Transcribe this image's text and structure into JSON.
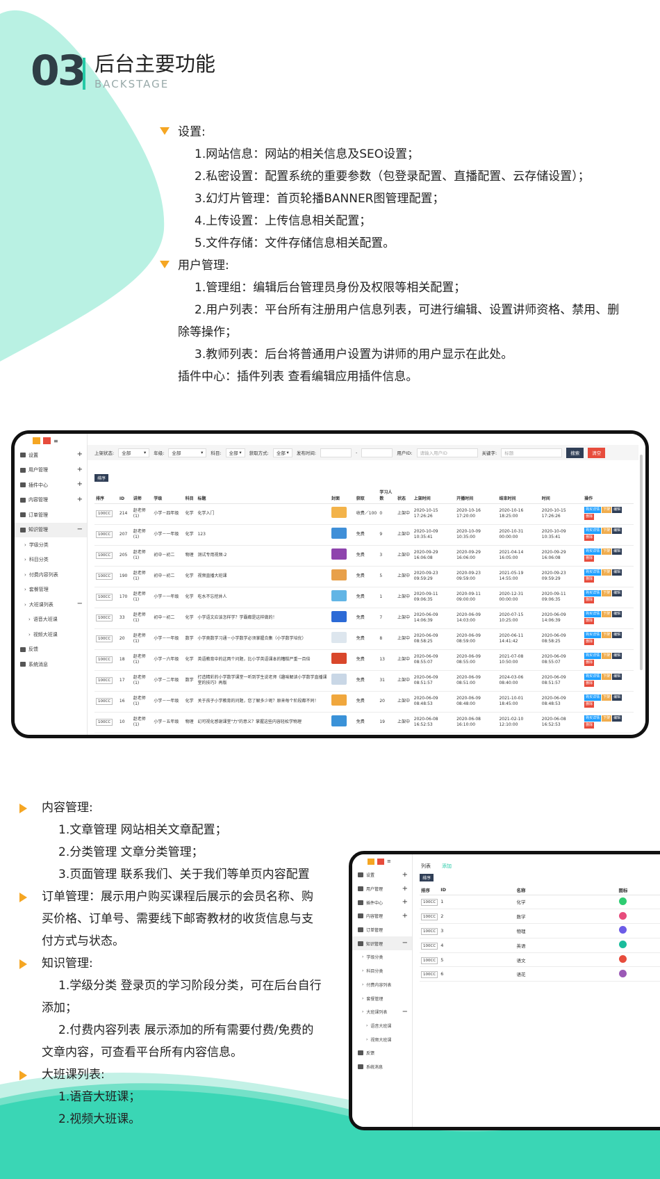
{
  "header": {
    "number": "03",
    "title": "后台主要功能",
    "subtitle": "BACKSTAGE"
  },
  "colors": {
    "accent": "#25c9a6",
    "bullet": "#f5a623",
    "blob": "#b9f1e3",
    "wave": "#3ad6b5"
  },
  "section1": {
    "lines": [
      {
        "type": "head",
        "text": "设置:"
      },
      {
        "type": "item",
        "text": "1.网站信息：网站的相关信息及SEO设置；"
      },
      {
        "type": "item",
        "text": "2.私密设置：配置系统的重要参数（包登录配置、直播配置、云存储设置）；"
      },
      {
        "type": "item",
        "text": "3.幻灯片管理：首页轮播BANNER图管理配置；"
      },
      {
        "type": "item",
        "text": "4.上传设置：上传信息相关配置；"
      },
      {
        "type": "item",
        "text": "5.文件存储：文件存储信息相关配置。"
      },
      {
        "type": "head",
        "text": "用户管理:"
      },
      {
        "type": "item",
        "text": "1.管理组：编辑后台管理员身份及权限等相关配置；"
      },
      {
        "type": "item",
        "text": "2.用户列表：平台所有注册用户信息列表，可进行编辑、设置讲师资格、禁用、删"
      },
      {
        "type": "cont",
        "text": "除等操作；"
      },
      {
        "type": "item",
        "text": "3.教师列表：后台将普通用户设置为讲师的用户显示在此处。"
      },
      {
        "type": "plain",
        "text": "插件中心：插件列表 查看编辑应用插件信息。"
      }
    ]
  },
  "section2": {
    "lines": [
      {
        "type": "head",
        "text": "内容管理:"
      },
      {
        "type": "item",
        "text": "1.文章管理 网站相关文章配置；"
      },
      {
        "type": "item",
        "text": "2.分类管理 文章分类管理；"
      },
      {
        "type": "item",
        "text": "3.页面管理 联系我们、关于我们等单页内容配置"
      },
      {
        "type": "head",
        "text": "订单管理：展示用户购买课程后展示的会员名称、购"
      },
      {
        "type": "cont",
        "text": "买价格、订单号、需要线下邮寄教材的收货信息与支"
      },
      {
        "type": "cont",
        "text": "付方式与状态。"
      },
      {
        "type": "head",
        "text": "知识管理:"
      },
      {
        "type": "item",
        "text": "1.学级分类 登录页的学习阶段分类，可在后台自行"
      },
      {
        "type": "cont",
        "text": "添加；"
      },
      {
        "type": "item",
        "text": " 2.付费内容列表 展示添加的所有需要付费/免费的"
      },
      {
        "type": "cont",
        "text": "文章内容，可查看平台所有内容信息。"
      },
      {
        "type": "head",
        "text": "大班课列表:"
      },
      {
        "type": "item",
        "text": "1.语音大班课；"
      },
      {
        "type": "item",
        "text": "2.视频大班课。"
      }
    ]
  },
  "sidebar": {
    "items": [
      {
        "label": "设置",
        "pm": "+",
        "level": 0,
        "icon": "gear-icon"
      },
      {
        "label": "用户管理",
        "pm": "+",
        "level": 0,
        "icon": "users-icon"
      },
      {
        "label": "插件中心",
        "pm": "+",
        "level": 0,
        "icon": "cloud-icon"
      },
      {
        "label": "内容管理",
        "pm": "+",
        "level": 0,
        "icon": "grid-icon"
      },
      {
        "label": "订单管理",
        "pm": "",
        "level": 0,
        "icon": "monitor-icon"
      },
      {
        "label": "知识管理",
        "pm": "−",
        "level": 0,
        "icon": "monitor-icon",
        "active": true
      },
      {
        "label": "学级分类",
        "pm": "",
        "level": 1
      },
      {
        "label": "科目分类",
        "pm": "",
        "level": 1
      },
      {
        "label": "付费内容列表",
        "pm": "",
        "level": 1
      },
      {
        "label": "套餐管理",
        "pm": "",
        "level": 1
      },
      {
        "label": "大班课列表",
        "pm": "−",
        "level": 1
      },
      {
        "label": "语音大班课",
        "pm": "",
        "level": 2
      },
      {
        "label": "视频大班课",
        "pm": "",
        "level": 2
      },
      {
        "label": "反馈",
        "pm": "",
        "level": 0,
        "icon": "monitor-icon"
      },
      {
        "label": "系统消息",
        "pm": "",
        "level": 0,
        "icon": "monitor-icon"
      }
    ]
  },
  "filters": {
    "status_label": "上架状态:",
    "status_value": "全部",
    "grade_label": "年级:",
    "grade_value": "全部",
    "subject_label": "科目:",
    "subject_value": "全部",
    "method_label": "获取方式:",
    "method_value": "全部",
    "time_label": "发布时间:",
    "time_sep": "-",
    "uid_label": "用户ID:",
    "uid_placeholder": "请输入用户ID",
    "kw_label": "关键字:",
    "kw_placeholder": "标题",
    "search_button": "搜索",
    "clear_button": "清空"
  },
  "table1": {
    "tag": "排序",
    "headers": [
      "排序",
      "ID",
      "讲师",
      "学级",
      "科目",
      "标题",
      "封面",
      "获取",
      "学习人数",
      "状态",
      "上架时间",
      "开播时间",
      "结束时间",
      "时间",
      "操作"
    ],
    "rows": [
      {
        "order": "100CC",
        "id": "214",
        "teacher": "赵老师(1)",
        "grade": "小学－四年级",
        "subject": "化学",
        "title": "化学入门",
        "cover": "#f3b34a",
        "get": "收费／100",
        "learn": "0",
        "status": "上架中",
        "up": "2020-10-15 17:26:26",
        "start": "2020-10-16 17:20:00",
        "end": "2020-10-16 18:25:00",
        "time": "2020-10-15 17:26:26"
      },
      {
        "order": "100CC",
        "id": "207",
        "teacher": "赵老师(1)",
        "grade": "小学－一年级",
        "subject": "化学",
        "title": "123",
        "cover": "#3f8fd8",
        "get": "免费",
        "learn": "9",
        "status": "上架中",
        "up": "2020-10-09 10:35:41",
        "start": "2020-10-09 10:35:00",
        "end": "2020-10-31 00:00:00",
        "time": "2020-10-09 10:35:41"
      },
      {
        "order": "100CC",
        "id": "205",
        "teacher": "赵老师(1)",
        "grade": "初中－初二",
        "subject": "物理",
        "title": "测试专用视频-2",
        "cover": "#8e44ad",
        "get": "免费",
        "learn": "3",
        "status": "上架中",
        "up": "2020-09-29 16:06:08",
        "start": "2020-09-29 16:06:00",
        "end": "2021-04-14 16:05:00",
        "time": "2020-09-29 16:06:08"
      },
      {
        "order": "100CC",
        "id": "190",
        "teacher": "赵老师(1)",
        "grade": "初中－初二",
        "subject": "化学",
        "title": "视频直播大班课",
        "cover": "#e8a04a",
        "get": "免费",
        "learn": "5",
        "status": "上架中",
        "up": "2020-09-23 09:59:29",
        "start": "2020-09-23 09:59:00",
        "end": "2021-05-19 14:55:00",
        "time": "2020-09-23 09:59:29"
      },
      {
        "order": "100CC",
        "id": "170",
        "teacher": "赵老师(1)",
        "grade": "小学－一年级",
        "subject": "化学",
        "title": "吃水不忘挖井人",
        "cover": "#62b5e5",
        "get": "免费",
        "learn": "1",
        "status": "上架中",
        "up": "2020-09-11 09:06:35",
        "start": "2020-09-11 09:00:00",
        "end": "2020-12-31 00:00:00",
        "time": "2020-09-11 09:06:35"
      },
      {
        "order": "100CC",
        "id": "33",
        "teacher": "赵老师(1)",
        "grade": "初中－初二",
        "subject": "化学",
        "title": "小学语文应该怎样学？学霸都是这样做的！",
        "cover": "#2c6ad6",
        "get": "免费",
        "learn": "7",
        "status": "上架中",
        "up": "2020-06-09 14:06:39",
        "start": "2020-06-09 14:03:00",
        "end": "2020-07-15 10:25:00",
        "time": "2020-06-09 14:06:39"
      },
      {
        "order": "100CC",
        "id": "20",
        "teacher": "赵老师(1)",
        "grade": "小学－一年级",
        "subject": "数学",
        "title": "小学奥数学习通－小学数学必须掌握合集（小学数学培优）",
        "cover": "#dde6ee",
        "get": "免费",
        "learn": "8",
        "status": "上架中",
        "up": "2020-06-09 08:58:25",
        "start": "2020-06-09 08:59:00",
        "end": "2020-06-11 14:41:42",
        "time": "2020-06-09 08:58:25"
      },
      {
        "order": "100CC",
        "id": "18",
        "teacher": "赵老师(1)",
        "grade": "小学－六年级",
        "subject": "化学",
        "title": "英语教育中的这两个问题，比小学英语课本的糟糕严重一百倍",
        "cover": "#d9472b",
        "get": "免费",
        "learn": "13",
        "status": "上架中",
        "up": "2020-06-09 08:55:07",
        "start": "2020-06-09 08:55:00",
        "end": "2021-07-08 10:50:00",
        "time": "2020-06-09 08:55:07"
      },
      {
        "order": "100CC",
        "id": "17",
        "teacher": "赵老师(1)",
        "grade": "小学－二年级",
        "subject": "数学",
        "title": "打造精彩的小学数学课堂一听到学生说老师《趣味解读小学数学直播课堂的技巧》再版",
        "cover": "#c9d7e6",
        "get": "免费",
        "learn": "31",
        "status": "上架中",
        "up": "2020-06-09 08:51:57",
        "start": "2020-06-09 08:51:00",
        "end": "2024-03-06 08:40:00",
        "time": "2020-06-09 08:51:57"
      },
      {
        "order": "100CC",
        "id": "16",
        "teacher": "赵老师(1)",
        "grade": "小学－一年级",
        "subject": "化学",
        "title": "关于孩子小学教育的问题，您了解多少呢？原来每个阶段都不同！",
        "cover": "#f0a73d",
        "get": "免费",
        "learn": "20",
        "status": "上架中",
        "up": "2020-06-09 08:48:53",
        "start": "2020-06-09 08:48:00",
        "end": "2021-10-01 18:45:00",
        "time": "2020-06-09 08:48:53"
      },
      {
        "order": "100CC",
        "id": "10",
        "teacher": "赵老师(1)",
        "grade": "小学－五年级",
        "subject": "物理",
        "title": "幻可视化感谢课堂\"力\"的意义？掌握这些内容轻松学物理",
        "cover": "#3a92d8",
        "get": "免费",
        "learn": "19",
        "status": "上架中",
        "up": "2020-06-08 16:52:53",
        "start": "2020-06-08 16:10:00",
        "end": "2021-02-10 12:10:00",
        "time": "2020-06-08 16:52:53"
      }
    ],
    "actions": [
      {
        "label": "购买详情",
        "color": "#1e9fff"
      },
      {
        "label": "下架",
        "color": "#f0ad4e"
      },
      {
        "label": "编辑",
        "color": "#2f3e56"
      },
      {
        "label": "删除",
        "color": "#e74c3c"
      }
    ]
  },
  "mock2": {
    "tabs": [
      "列表",
      "添加"
    ],
    "tag": "排序",
    "headers": [
      "排序",
      "ID",
      "名称",
      "图标"
    ],
    "rows": [
      {
        "order": "100CC",
        "id": "1",
        "name": "化学",
        "color": "#2ecc71"
      },
      {
        "order": "100CC",
        "id": "2",
        "name": "数学",
        "color": "#e74c7c"
      },
      {
        "order": "100CC",
        "id": "3",
        "name": "物理",
        "color": "#6c5ce7"
      },
      {
        "order": "100CC",
        "id": "4",
        "name": "英语",
        "color": "#1abc9c"
      },
      {
        "order": "100CC",
        "id": "5",
        "name": "语文",
        "color": "#e74c3c"
      },
      {
        "order": "100CC",
        "id": "6",
        "name": "语花",
        "color": "#9b59b6"
      }
    ]
  }
}
